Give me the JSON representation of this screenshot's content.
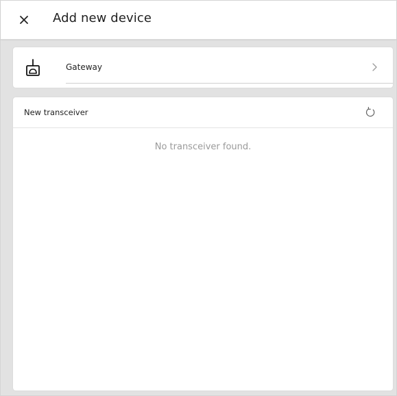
{
  "header": {
    "title": "Add new device",
    "close_icon": "close-icon"
  },
  "gateway": {
    "label": "Gateway",
    "icon": "gateway-router-icon",
    "chevron_icon": "chevron-right-icon"
  },
  "transceivers": {
    "section_title": "New transceiver",
    "refresh_icon": "refresh-icon",
    "empty_message": "No transceiver found."
  },
  "colors": {
    "background": "#e2e2e2",
    "card": "#ffffff",
    "text": "#222222",
    "muted_text": "#9a9a9a",
    "divider": "#d0d0d0"
  }
}
